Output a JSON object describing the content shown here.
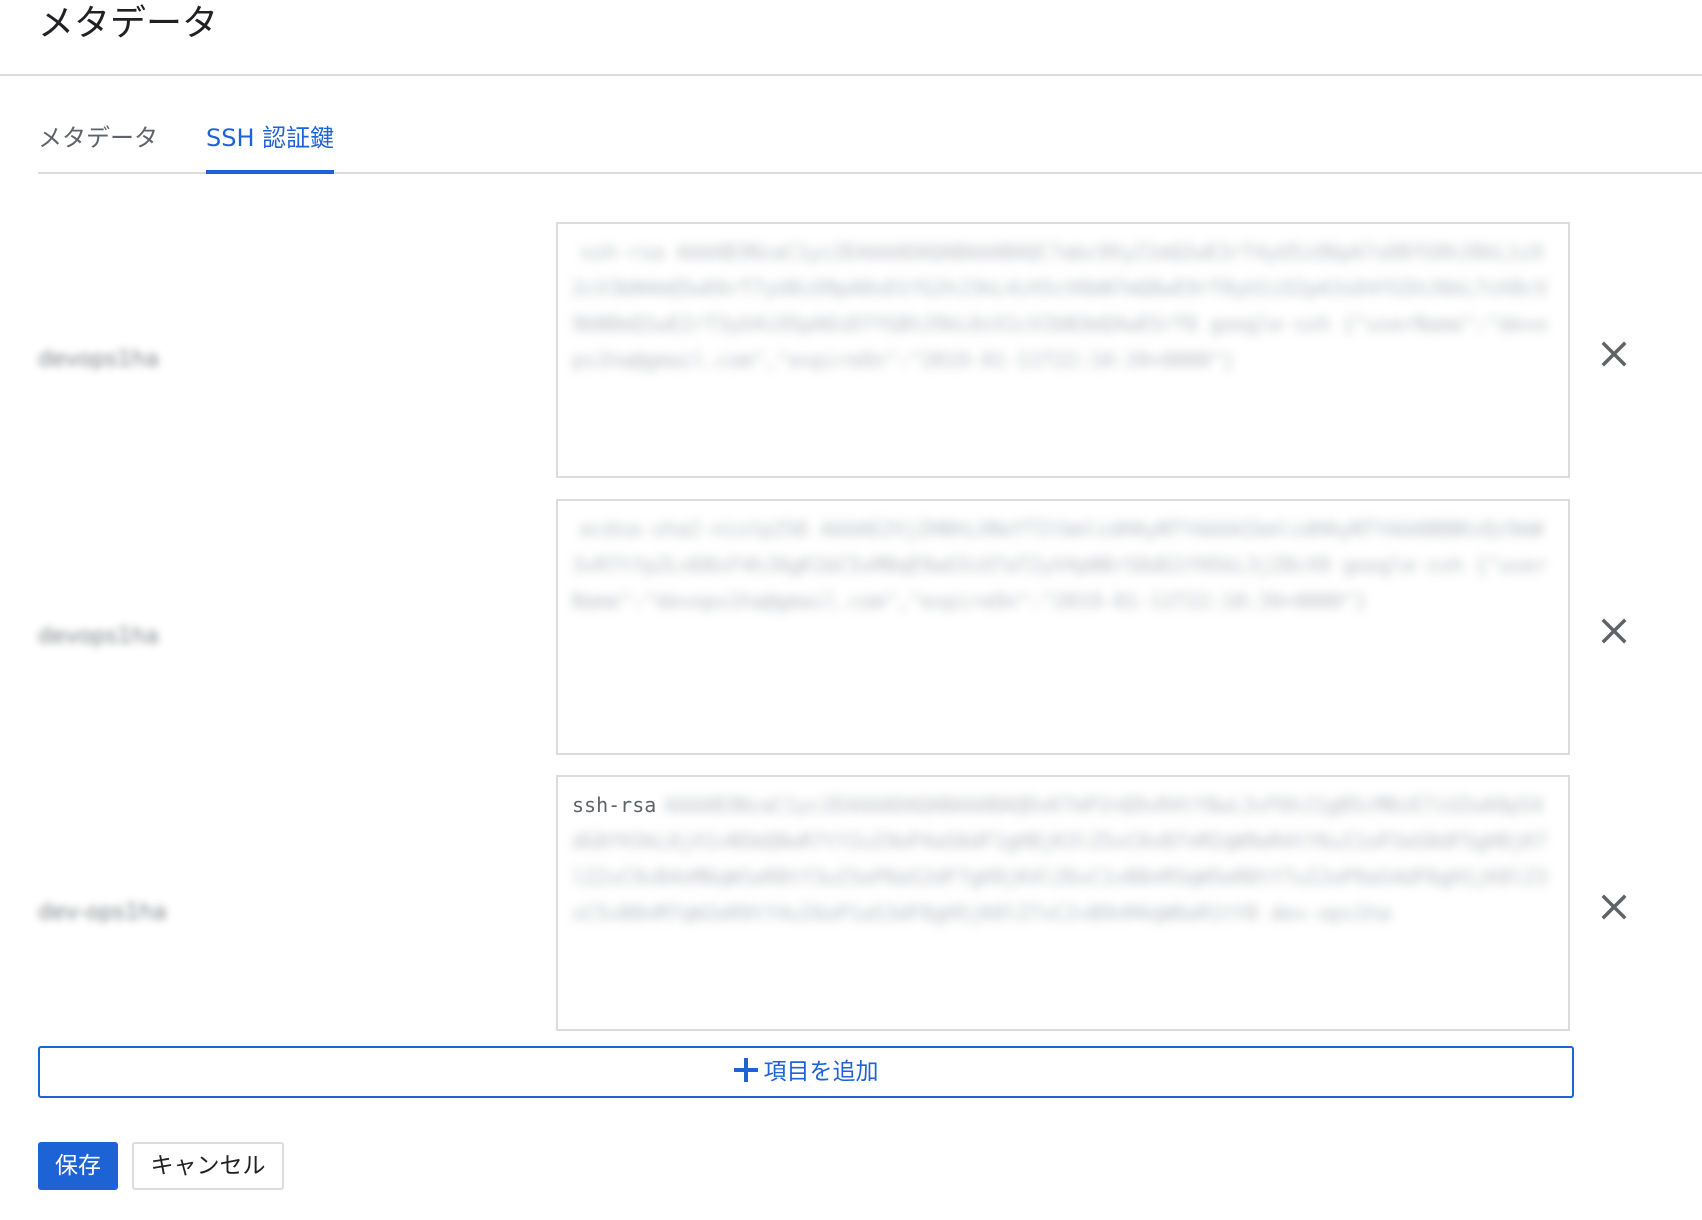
{
  "page": {
    "title": "メタデータ"
  },
  "tabs": [
    {
      "label": "メタデータ",
      "active": false
    },
    {
      "label": "SSH 認証鍵",
      "active": true
    }
  ],
  "ssh_keys": [
    {
      "username": "devops1ha",
      "key_prefix": "",
      "key_blurred": "ssh-rsa AAAAB3NzaC1yc2EAAAADAQABAAABAQC7abc9XyZ1mQ2wE3rT4yU5iO6pA7sD8fG9hJ0kL1zX2cV3bN4mQ5wE6rT7yU8iO9pA0sD1fG2hJ3kL4zX5cV6bN7mQ8wE9rT0yU1iO2pA3sD4fG5hJ6kL7zX8cV9bN0mQ1wE2rT3yU4iO5pA6sD7fG8hJ9kL0zX1cV2bN3mQ4wE5rT6 google-ssh {\"userName\":\"devops1ha@gmail.com\",\"expireOn\":\"2019-01-11T22:10:39+0000\"}"
    },
    {
      "username": "devops1ha",
      "key_prefix": "",
      "key_blurred": "ecdsa-sha2-nistp256 AAAAE2VjZHNhLXNoYTItbmlzdHAyNTYAAAAIbmlzdHAyNTYAAABBBKxQz9mW3vR7tYp2LnD8sF4hJ6gK1bC5xM0qE9wU3iO7aT2yV4pN8rS6dG1fH5kL3jZ0cX9 google-ssh {\"userName\":\"devops1ha@gmail.com\",\"expireOn\":\"2019-01-11T22:10:39+0000\"}"
    },
    {
      "username": "dev-ops1ha",
      "key_prefix": "ssh-rsa",
      "key_blurred": "AAAAB3NzaC1yc2EAAAADAQABAAABAQDxK7mP2nQ9vR4tY8wL3sF6hJ1gB5cM0zE7iU2oA9pS4dG8fH3kL6jX1vN5bQ0wR7tY2uI9oP4aS6dF1gH8jK3lZ5xC0vB7nM2qW9eR4tY6uI1oP3aS8dF5gH0jK7lZ2xC9vB4nM6qW1eR8tY3uI5oP0aS2dF7gH9jK4lZ6xC1vB8nM3qW5eR0tY7uI2oP9aS4dF6gH1jK8lZ3xC5vB0nM7qW2eR9tY4uI6oP1aS3dF8gH5jK0lZ7xC2vB9nM4qW6eR1tY8 dev-ops1ha"
    }
  ],
  "actions": {
    "add_item_label": "項目を追加",
    "save_label": "保存",
    "cancel_label": "キャンセル"
  },
  "icons": {
    "remove": "close-icon",
    "add": "plus-icon"
  },
  "colors": {
    "accent": "#1e63d6",
    "divider": "#dadce0",
    "text": "#202124",
    "muted": "#5f6368"
  }
}
